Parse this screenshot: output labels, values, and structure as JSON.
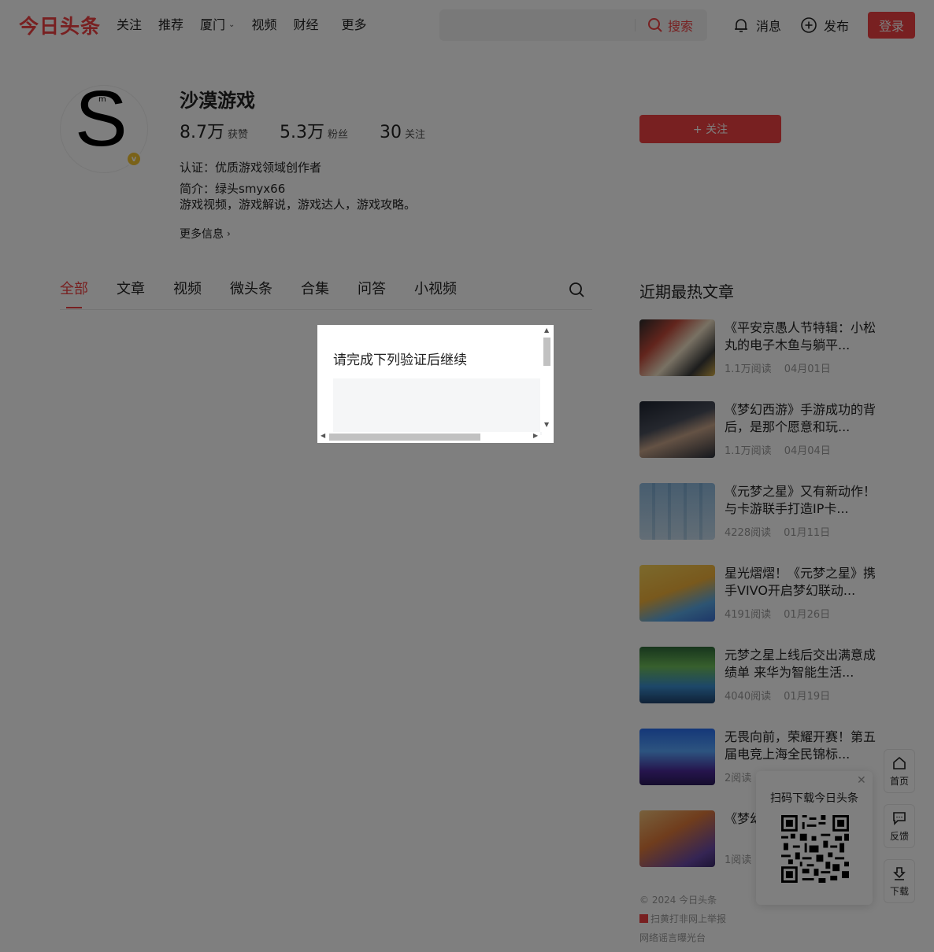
{
  "header": {
    "logo": "今日头条",
    "nav": [
      "关注",
      "推荐",
      "厦门",
      "视频",
      "财经",
      "更多"
    ],
    "search": {
      "placeholder": "",
      "button_label": "搜索"
    },
    "messages_label": "消息",
    "publish_label": "发布",
    "login_label": "登录"
  },
  "profile": {
    "name": "沙漠游戏",
    "avatar_letter": "S",
    "avatar_small": "m",
    "stats": [
      {
        "num": "8.7万",
        "label": "获赞"
      },
      {
        "num": "5.3万",
        "label": "粉丝"
      },
      {
        "num": "30",
        "label": "关注"
      }
    ],
    "follow_label": "+ 关注",
    "certification": "认证：优质游戏领域创作者",
    "intro_line1": "简介：绿头smyx66",
    "intro_line2": "游戏视频，游戏解说，游戏达人，游戏攻略。",
    "more_info": "更多信息"
  },
  "tabs": [
    "全部",
    "文章",
    "视频",
    "微头条",
    "合集",
    "问答",
    "小视频"
  ],
  "recent": {
    "title": "近期最热文章",
    "articles": [
      {
        "title": "《平安京愚人节特辑：小松丸的电子木鱼与躺平...",
        "reads": "1.1万阅读",
        "date": "04月01日"
      },
      {
        "title": "《梦幻西游》手游成功的背后，是那个愿意和玩...",
        "reads": "1.1万阅读",
        "date": "04月04日"
      },
      {
        "title": "《元梦之星》又有新动作！与卡游联手打造IP卡...",
        "reads": "4228阅读",
        "date": "01月11日"
      },
      {
        "title": "星光熠熠！《元梦之星》携手VIVO开启梦幻联动...",
        "reads": "4191阅读",
        "date": "01月26日"
      },
      {
        "title": "元梦之星上线后交出满意成绩单 来华为智能生活...",
        "reads": "4040阅读",
        "date": "01月19日"
      },
      {
        "title": "无畏向前，荣耀开赛！第五届电竞上海全民锦标...",
        "reads": "2阅读",
        "date": ""
      },
      {
        "title": "《梦幻职系统",
        "reads": "1阅读",
        "date": ""
      }
    ]
  },
  "footer": {
    "copyright": "© 2024 今日头条",
    "report": "扫黄打非网上举报",
    "rumor": "网络谣言曝光台"
  },
  "side_tools": {
    "home": "首页",
    "feedback": "反馈",
    "download": "下载"
  },
  "qr": {
    "title": "扫码下载今日头条"
  },
  "modal": {
    "title": "请完成下列验证后继续"
  },
  "colors": {
    "brand": "#f04142"
  }
}
